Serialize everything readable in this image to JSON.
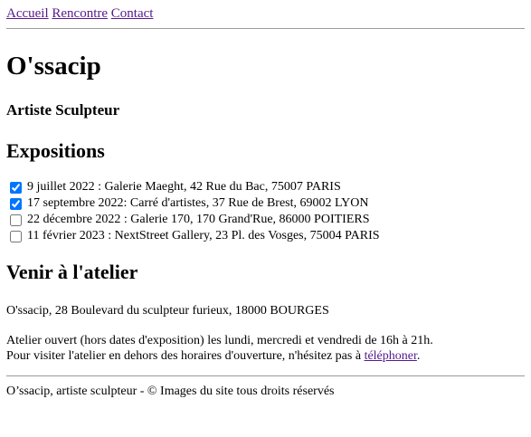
{
  "nav": {
    "links": [
      "Accueil",
      "Rencontre",
      "Contact"
    ],
    "link_color": "#551a8b"
  },
  "header": {
    "title": "O'ssacip",
    "subtitle": "Artiste Sculpteur"
  },
  "expositions": {
    "heading": "Expositions",
    "items": [
      {
        "label": "9 juillet 2022 : Galerie Maeght, 42 Rue du Bac, 75007 PARIS",
        "checked": true
      },
      {
        "label": "17 septembre 2022: Carré d'artistes, 37 Rue de Brest, 69002 LYON",
        "checked": true
      },
      {
        "label": "22 décembre 2022 : Galerie 170, 170 Grand'Rue, 86000 POITIERS",
        "checked": false
      },
      {
        "label": "11 février 2023 : NextStreet Gallery, 23 Pl. des Vosges, 75004 PARIS",
        "checked": false
      }
    ]
  },
  "atelier": {
    "heading": "Venir à l'atelier",
    "address": "O'ssacip, 28 Boulevard du sculpteur furieux, 18000 BOURGES",
    "hours_line": "Atelier ouvert (hors dates d'exposition) les lundi, mercredi et vendredi de 16h à 21h.",
    "visit_text": "Pour visiter l'atelier en dehors des horaires d'ouverture, n'hésitez pas à",
    "phone_link": "téléphoner",
    "visit_end": "."
  },
  "footer": {
    "text": "O’ssacip, artiste sculpteur - © Images du site tous droits réservés"
  }
}
